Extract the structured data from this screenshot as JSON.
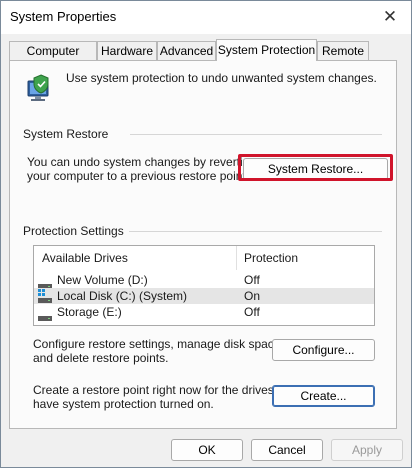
{
  "window": {
    "title": "System Properties",
    "close_symbol": "✕"
  },
  "tabs": [
    {
      "label": "Computer Name",
      "active": false
    },
    {
      "label": "Hardware",
      "active": false
    },
    {
      "label": "Advanced",
      "active": false
    },
    {
      "label": "System Protection",
      "active": true
    },
    {
      "label": "Remote",
      "active": false
    }
  ],
  "intro": {
    "text": "Use system protection to undo unwanted system changes.",
    "icon": "system-protection-icon"
  },
  "system_restore": {
    "group_label": "System Restore",
    "description_line1": "You can undo system changes by reverting",
    "description_line2": "your computer to a previous restore point.",
    "button_label": "System Restore..."
  },
  "protection": {
    "group_label": "Protection Settings",
    "columns": [
      "Available Drives",
      "Protection"
    ],
    "rows": [
      {
        "drive": "New Volume (D:)",
        "protection": "Off",
        "selected": false,
        "icon": "drive-icon"
      },
      {
        "drive": "Local Disk (C:) (System)",
        "protection": "On",
        "selected": true,
        "icon": "system-drive-icon"
      },
      {
        "drive": "Storage (E:)",
        "protection": "Off",
        "selected": false,
        "icon": "drive-icon"
      }
    ],
    "configure_text_line1": "Configure restore settings, manage disk space,",
    "configure_text_line2": "and delete restore points.",
    "configure_button": "Configure...",
    "create_text_line1": "Create a restore point right now for the drives that",
    "create_text_line2": "have system protection turned on.",
    "create_button": "Create..."
  },
  "footer": {
    "ok": "OK",
    "cancel": "Cancel",
    "apply": "Apply"
  },
  "colors": {
    "highlight": "#d0142b",
    "focus": "#3c6fb3"
  }
}
